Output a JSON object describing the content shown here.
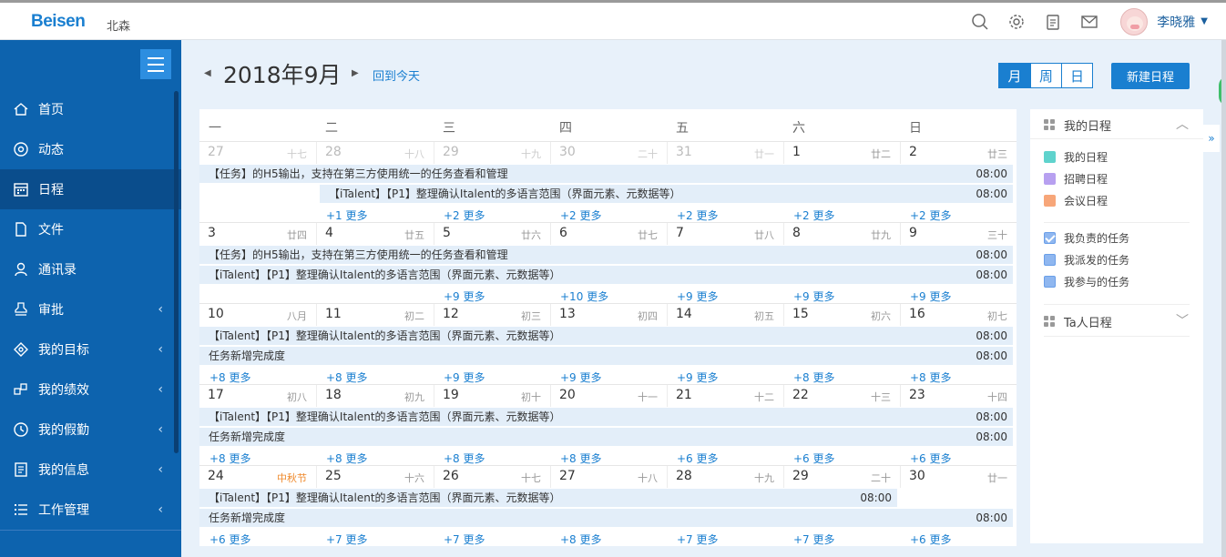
{
  "topbar": {
    "logo": "Beisen",
    "company": "北森",
    "user_name": "李晓雅",
    "icons": [
      "search-icon",
      "gear-icon",
      "clipboard-icon",
      "mail-icon"
    ]
  },
  "sidebar": {
    "items": [
      {
        "label": "首页",
        "icon": "home-icon",
        "active": false,
        "submenu": false
      },
      {
        "label": "动态",
        "icon": "activity-icon",
        "active": false,
        "submenu": false
      },
      {
        "label": "日程",
        "icon": "calendar-icon",
        "active": true,
        "submenu": false
      },
      {
        "label": "文件",
        "icon": "file-icon",
        "active": false,
        "submenu": false
      },
      {
        "label": "通讯录",
        "icon": "contact-icon",
        "active": false,
        "submenu": false
      },
      {
        "label": "审批",
        "icon": "approval-icon",
        "active": false,
        "submenu": true
      },
      {
        "label": "我的目标",
        "icon": "target-icon",
        "active": false,
        "submenu": true
      },
      {
        "label": "我的绩效",
        "icon": "performance-icon",
        "active": false,
        "submenu": true
      },
      {
        "label": "我的假勤",
        "icon": "clock-icon",
        "active": false,
        "submenu": true
      },
      {
        "label": "我的信息",
        "icon": "info-icon",
        "active": false,
        "submenu": true
      },
      {
        "label": "工作管理",
        "icon": "list-icon",
        "active": false,
        "submenu": true
      }
    ]
  },
  "header": {
    "month_title": "2018年9月",
    "today_link": "回到今天",
    "views": [
      "月",
      "周",
      "日"
    ],
    "active_view": "月",
    "new_button": "新建日程"
  },
  "calendar": {
    "weekdays": [
      "一",
      "二",
      "三",
      "四",
      "五",
      "六",
      "日"
    ],
    "weeks": [
      {
        "days": [
          {
            "num": "27",
            "lunar": "十七",
            "other": true
          },
          {
            "num": "28",
            "lunar": "十八",
            "other": true
          },
          {
            "num": "29",
            "lunar": "十九",
            "other": true
          },
          {
            "num": "30",
            "lunar": "二十",
            "other": true
          },
          {
            "num": "31",
            "lunar": "廿一",
            "other": true
          },
          {
            "num": "1",
            "lunar": "廿二",
            "other": false
          },
          {
            "num": "2",
            "lunar": "廿三",
            "other": false
          }
        ],
        "events": [
          {
            "text": "【任务】的H5输出，支持在第三方使用统一的任务查看和管理",
            "time": "08:00",
            "start": 0,
            "span": 7,
            "row": 0
          },
          {
            "text": "【iTalent】【P1】整理确认Italent的多语言范围（界面元素、元数据等）",
            "time": "08:00",
            "start": 1,
            "span": 6,
            "row": 1
          }
        ],
        "more": [
          "",
          "+1 更多",
          "+2 更多",
          "+2 更多",
          "+2 更多",
          "+2 更多",
          "+2 更多"
        ]
      },
      {
        "days": [
          {
            "num": "3",
            "lunar": "廿四"
          },
          {
            "num": "4",
            "lunar": "廿五"
          },
          {
            "num": "5",
            "lunar": "廿六"
          },
          {
            "num": "6",
            "lunar": "廿七"
          },
          {
            "num": "7",
            "lunar": "廿八"
          },
          {
            "num": "8",
            "lunar": "廿九"
          },
          {
            "num": "9",
            "lunar": "三十"
          }
        ],
        "events": [
          {
            "text": "【任务】的H5输出，支持在第三方使用统一的任务查看和管理",
            "time": "08:00",
            "start": 0,
            "span": 7,
            "row": 0
          },
          {
            "text": "【iTalent】【P1】整理确认Italent的多语言范围（界面元素、元数据等）",
            "time": "08:00",
            "start": 0,
            "span": 7,
            "row": 1
          }
        ],
        "more": [
          "",
          "",
          "+9 更多",
          "+10 更多",
          "+9 更多",
          "+9 更多",
          "+9 更多"
        ]
      },
      {
        "days": [
          {
            "num": "10",
            "lunar": "八月"
          },
          {
            "num": "11",
            "lunar": "初二"
          },
          {
            "num": "12",
            "lunar": "初三"
          },
          {
            "num": "13",
            "lunar": "初四"
          },
          {
            "num": "14",
            "lunar": "初五"
          },
          {
            "num": "15",
            "lunar": "初六"
          },
          {
            "num": "16",
            "lunar": "初七"
          }
        ],
        "events": [
          {
            "text": "【iTalent】【P1】整理确认Italent的多语言范围（界面元素、元数据等）",
            "time": "08:00",
            "start": 0,
            "span": 7,
            "row": 0
          },
          {
            "text": "任务新增完成度",
            "time": "08:00",
            "start": 0,
            "span": 7,
            "row": 1
          }
        ],
        "more": [
          "+8 更多",
          "+8 更多",
          "+9 更多",
          "+9 更多",
          "+9 更多",
          "+8 更多",
          "+8 更多"
        ]
      },
      {
        "days": [
          {
            "num": "17",
            "lunar": "初八"
          },
          {
            "num": "18",
            "lunar": "初九"
          },
          {
            "num": "19",
            "lunar": "初十"
          },
          {
            "num": "20",
            "lunar": "十一"
          },
          {
            "num": "21",
            "lunar": "十二"
          },
          {
            "num": "22",
            "lunar": "十三"
          },
          {
            "num": "23",
            "lunar": "十四"
          }
        ],
        "events": [
          {
            "text": "【iTalent】【P1】整理确认Italent的多语言范围（界面元素、元数据等）",
            "time": "08:00",
            "start": 0,
            "span": 7,
            "row": 0
          },
          {
            "text": "任务新增完成度",
            "time": "08:00",
            "start": 0,
            "span": 7,
            "row": 1
          }
        ],
        "more": [
          "+8 更多",
          "+8 更多",
          "+8 更多",
          "+8 更多",
          "+6 更多",
          "+6 更多",
          "+6 更多"
        ]
      },
      {
        "days": [
          {
            "num": "24",
            "lunar": "中秋节",
            "festival": true
          },
          {
            "num": "25",
            "lunar": "十六"
          },
          {
            "num": "26",
            "lunar": "十七"
          },
          {
            "num": "27",
            "lunar": "十八"
          },
          {
            "num": "28",
            "lunar": "十九"
          },
          {
            "num": "29",
            "lunar": "二十"
          },
          {
            "num": "30",
            "lunar": "廿一"
          }
        ],
        "events": [
          {
            "text": "【iTalent】【P1】整理确认Italent的多语言范围（界面元素、元数据等）",
            "time": "08:00",
            "start": 0,
            "span": 6,
            "row": 0
          },
          {
            "text": "任务新增完成度",
            "time": "08:00",
            "start": 0,
            "span": 7,
            "row": 1
          }
        ],
        "more": [
          "+6 更多",
          "+7 更多",
          "+7 更多",
          "+8 更多",
          "+7 更多",
          "+7 更多",
          "+6 更多"
        ]
      }
    ]
  },
  "right_panel": {
    "my_schedule_title": "我的日程",
    "legend": [
      {
        "label": "我的日程",
        "color": "#5fd3cd"
      },
      {
        "label": "招聘日程",
        "color": "#b7a0f0"
      },
      {
        "label": "会议日程",
        "color": "#f7a679"
      }
    ],
    "tasks": [
      {
        "label": "我负责的任务",
        "checked": true
      },
      {
        "label": "我派发的任务",
        "checked": false
      },
      {
        "label": "我参与的任务",
        "checked": false
      }
    ],
    "others_title": "Ta人日程",
    "side_tab": "»"
  }
}
